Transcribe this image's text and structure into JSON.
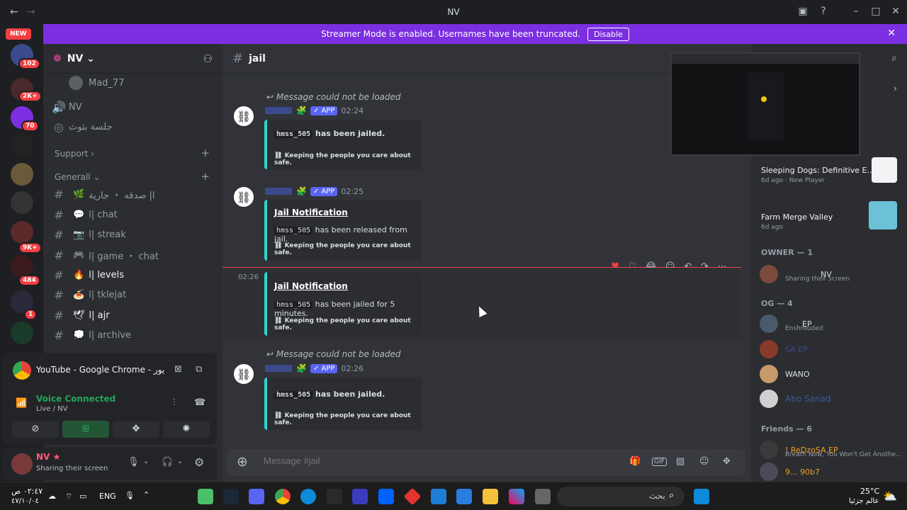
{
  "window": {
    "title": "NV"
  },
  "banner": {
    "text": "Streamer Mode is enabled. Usernames have been truncated.",
    "disable_label": "Disable"
  },
  "guilds": {
    "new_label": "NEW",
    "badges": [
      "102",
      "2K+",
      "70",
      "9K+",
      "484",
      "1"
    ]
  },
  "server": {
    "name": "NV ⌄",
    "voice_user": "Mad_77",
    "voice_channels": [
      "NV",
      "جلسة بثوث"
    ],
    "categories": [
      {
        "label": "Support ›"
      },
      {
        "label": "Generall ⌄"
      }
    ],
    "channels": [
      {
        "emoji": "🌿",
        "label": "ا| صدقه ・ جارية"
      },
      {
        "emoji": "💬",
        "label": "ا| chat"
      },
      {
        "emoji": "📷",
        "label": "ا| streak"
      },
      {
        "emoji": "🎮",
        "label": "ا| game ・ chat"
      },
      {
        "emoji": "🔥",
        "label": "ا| levels"
      },
      {
        "emoji": "🍝",
        "label": "ا| tklejat"
      },
      {
        "emoji": "🕊",
        "label": "ا| ajr"
      },
      {
        "emoji": "💭",
        "label": "ا| archive"
      }
    ]
  },
  "activity": {
    "app": "YouTube - Google Chrome - يور",
    "voice_status": "Voice Connected",
    "voice_sub": "Live / NV"
  },
  "user": {
    "name": "NV ★",
    "status": "Sharing their screen"
  },
  "channel": {
    "name": "jail"
  },
  "messages": [
    {
      "reply": "Message could not be loaded",
      "badge": "✓ APP",
      "time": "02:24",
      "title": "",
      "user": "hmss_505",
      "desc": "has been jailed.",
      "footer": "Keeping the people you care about safe."
    },
    {
      "reply": "",
      "badge": "✓ APP",
      "time": "02:25",
      "title": "Jail Notification",
      "user": "hmss_505",
      "desc": "has been released from jail.",
      "footer": "Keeping the people you care about safe."
    },
    {
      "reply": "",
      "badge": "",
      "time": "02:26",
      "title": "Jail Notification",
      "user": "hmss_505",
      "desc": "has been jailed for 5 minutes.",
      "footer": "Keeping the people you care about safe."
    },
    {
      "reply": "Message could not be loaded",
      "badge": "✓ APP",
      "time": "02:26",
      "title": "",
      "user": "hmss_505",
      "desc": "has been jailed.",
      "footer": "Keeping the people you care about safe."
    }
  ],
  "composer": {
    "placeholder": "Message #jail"
  },
  "activities": [
    {
      "title": "Sleeping Dogs: Definitive E...",
      "sub": "6d ago · New Player"
    },
    {
      "title": "Farm Merge Valley",
      "sub": "6d ago"
    }
  ],
  "members": {
    "owner_header": "OWNER — 1",
    "owner": [
      {
        "name": "NV",
        "sub": "Sharing their screen"
      }
    ],
    "og_header": "OG — 4",
    "og": [
      {
        "name": "EP",
        "sub": "Enshrouded"
      },
      {
        "name": "SA EP",
        "sub": ""
      },
      {
        "name": "WANO",
        "sub": ""
      },
      {
        "name": "Abo Sanad",
        "sub": ""
      }
    ],
    "friends_header": "Friends — 6",
    "friends": [
      {
        "name": "! ReDzoSA EP",
        "sub": "Breath Now, You Won't Get Anothe..."
      },
      {
        "name": "9... 90b7",
        "sub": ""
      }
    ]
  },
  "taskbar": {
    "time": "٠٢:٤٧ ص",
    "date": "٤٧/١٠/٠٤",
    "lang": "ENG",
    "temp": "25°C",
    "weather": "عالم جزئيا",
    "search": "بحث"
  }
}
